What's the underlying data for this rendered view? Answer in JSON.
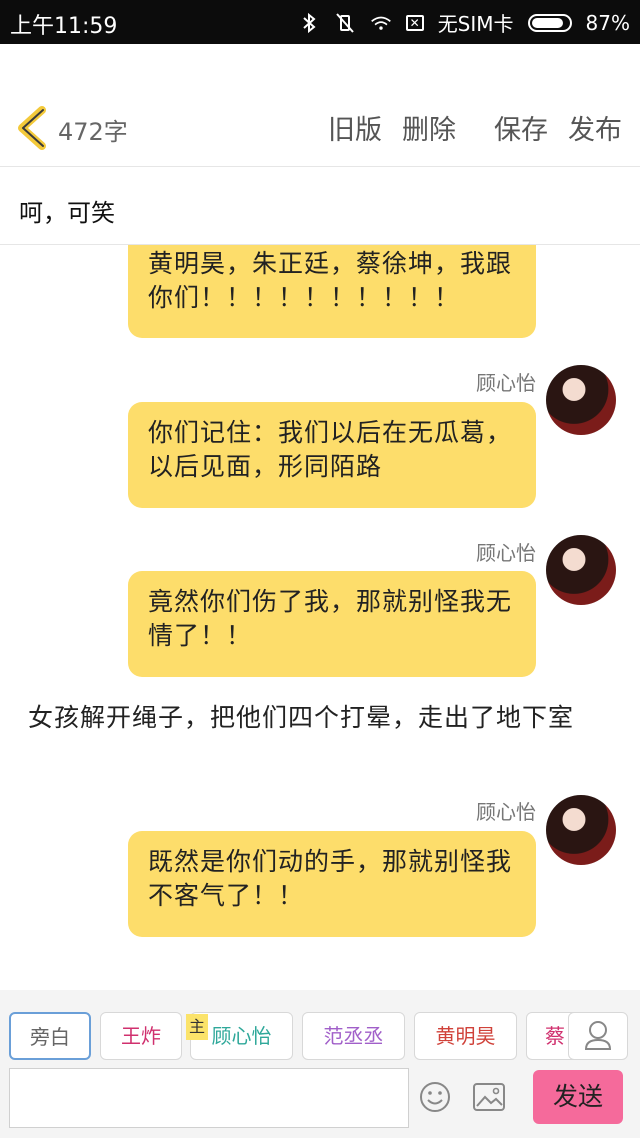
{
  "status_bar": {
    "time": "上午11:59",
    "carrier": "无SIM卡",
    "battery": "87%"
  },
  "header": {
    "word_count": "472字",
    "actions": {
      "old_version": "旧版",
      "delete": "删除",
      "save": "保存",
      "publish": "发布"
    }
  },
  "title": "呵，可笑",
  "messages": [
    {
      "kind": "bubble",
      "text": "黄明昊，朱正廷，蔡徐坤，我跟你们！！！！！！！！！！"
    },
    {
      "kind": "bubble",
      "sender": "顾心怡",
      "text": "你们记住：我们以后在无瓜葛，以后见面，形同陌路"
    },
    {
      "kind": "bubble",
      "sender": "顾心怡",
      "text": "竟然你们伤了我，那就别怪我无情了！！"
    },
    {
      "kind": "narration",
      "text": "女孩解开绳子，把他们四个打晕，走出了地下室"
    },
    {
      "kind": "bubble",
      "sender": "顾心怡",
      "text": "既然是你们动的手，那就别怪我不客气了！！"
    }
  ],
  "characters": [
    {
      "name": "旁白",
      "color": "#666666"
    },
    {
      "name": "王炸",
      "color": "#d0306e"
    },
    {
      "name": "顾心怡",
      "color": "#2fa89a",
      "badge": "主"
    },
    {
      "name": "范丞丞",
      "color": "#a15fc9"
    },
    {
      "name": "黄明昊",
      "color": "#d0423a"
    },
    {
      "name": "蔡",
      "color": "#d0306e"
    }
  ],
  "composer": {
    "input_value": "",
    "send_label": "发送"
  },
  "colors": {
    "bubble": "#fddd6b",
    "send": "#f56a9b",
    "header_back": "#f3c93a"
  }
}
